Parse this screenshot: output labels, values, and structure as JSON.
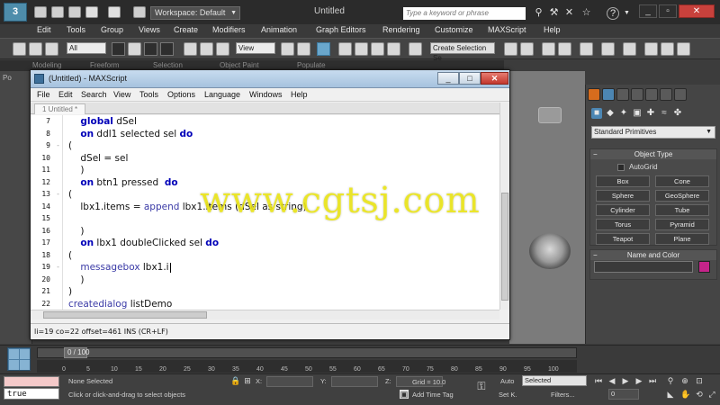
{
  "app": {
    "logo_text": "3",
    "workspace_label": "Workspace: Default",
    "document_title": "Untitled",
    "search_placeholder": "Type a keyword or phrase",
    "help_label": "?"
  },
  "main_menu": [
    "Edit",
    "Tools",
    "Group",
    "Views",
    "Create",
    "Modifiers",
    "Animation",
    "Graph Editors",
    "Rendering",
    "Customize",
    "MAXScript",
    "Help"
  ],
  "toolbar": {
    "filter_select": "All",
    "ref_coord_select": "View",
    "named_selection": "Create Selection Se"
  },
  "ribbon": {
    "tabs": [
      "Modeling",
      "Freeform",
      "Selection",
      "Object Paint",
      "Populate"
    ]
  },
  "left_strip_label": "Po",
  "command_panel": {
    "category_dropdown": "Standard Primitives",
    "object_type": {
      "header": "Object Type",
      "autogrid_label": "AutoGrid",
      "buttons": [
        "Box",
        "Cone",
        "Sphere",
        "GeoSphere",
        "Cylinder",
        "Tube",
        "Torus",
        "Pyramid",
        "Teapot",
        "Plane"
      ]
    },
    "name_and_color": {
      "header": "Name and Color",
      "swatch_color": "#c5248a"
    }
  },
  "editor": {
    "title": "(Untitled) - MAXScript",
    "menu": [
      "File",
      "Edit",
      "Search",
      "View",
      "Tools",
      "Options",
      "Language",
      "Windows",
      "Help"
    ],
    "tab_label": "1 Untitled *",
    "line_numbers": [
      "7",
      "8",
      "9",
      "10",
      "11",
      "12",
      "13",
      "14",
      "15",
      "16",
      "17",
      "18",
      "19",
      "20",
      "21",
      "22"
    ],
    "fold_markers": [
      "",
      "",
      "-",
      "",
      "",
      "",
      "-",
      "",
      "",
      "",
      "",
      "",
      "-",
      "",
      "",
      ""
    ],
    "lines": [
      {
        "indent": "    ",
        "tokens": [
          {
            "t": "kw",
            "v": "global"
          },
          {
            "t": "op",
            "v": " dSel"
          }
        ]
      },
      {
        "indent": "    ",
        "tokens": [
          {
            "t": "kw",
            "v": "on"
          },
          {
            "t": "op",
            "v": " ddl1 selected sel "
          },
          {
            "t": "kw",
            "v": "do"
          }
        ]
      },
      {
        "indent": "",
        "tokens": [
          {
            "t": "op",
            "v": "("
          }
        ]
      },
      {
        "indent": "    ",
        "tokens": [
          {
            "t": "op",
            "v": "dSel = sel"
          }
        ]
      },
      {
        "indent": "    ",
        "tokens": [
          {
            "t": "op",
            "v": ")"
          }
        ]
      },
      {
        "indent": "    ",
        "tokens": [
          {
            "t": "kw",
            "v": "on"
          },
          {
            "t": "op",
            "v": " btn1 pressed  "
          },
          {
            "t": "kw",
            "v": "do"
          }
        ]
      },
      {
        "indent": "",
        "tokens": [
          {
            "t": "op",
            "v": "("
          }
        ]
      },
      {
        "indent": "    ",
        "tokens": [
          {
            "t": "op",
            "v": "lbx1.items = "
          },
          {
            "t": "fn",
            "v": "append"
          },
          {
            "t": "op",
            "v": " lbx1.items (dSel as string)"
          }
        ]
      },
      {
        "indent": "",
        "tokens": []
      },
      {
        "indent": "    ",
        "tokens": [
          {
            "t": "op",
            "v": ")"
          }
        ]
      },
      {
        "indent": "    ",
        "tokens": [
          {
            "t": "kw",
            "v": "on"
          },
          {
            "t": "op",
            "v": " lbx1 doubleClicked sel "
          },
          {
            "t": "kw",
            "v": "do"
          }
        ]
      },
      {
        "indent": "",
        "tokens": [
          {
            "t": "op",
            "v": "("
          }
        ]
      },
      {
        "indent": "    ",
        "tokens": [
          {
            "t": "fn",
            "v": "messagebox"
          },
          {
            "t": "op",
            "v": " lbx1.i"
          }
        ],
        "caret": true
      },
      {
        "indent": "    ",
        "tokens": [
          {
            "t": "op",
            "v": ")"
          }
        ]
      },
      {
        "indent": "",
        "tokens": [
          {
            "t": "op",
            "v": ")"
          }
        ]
      },
      {
        "indent": "",
        "tokens": [
          {
            "t": "fn",
            "v": "createdialog"
          },
          {
            "t": "op",
            "v": " listDemo"
          }
        ]
      }
    ],
    "status_line": "li=19 co=22 offset=461 INS (CR+LF)"
  },
  "watermark": "www.cgtsj.com",
  "timeline": {
    "frame_label": "0 / 100",
    "ticks": [
      "0",
      "5",
      "10",
      "15",
      "20",
      "25",
      "30",
      "35",
      "40",
      "45",
      "50",
      "55",
      "60",
      "65",
      "70",
      "75",
      "80",
      "85",
      "90",
      "95",
      "100"
    ]
  },
  "status_bar": {
    "listener_result": "true",
    "selection_status": "None Selected",
    "prompt": "Click or click-and-drag to select objects",
    "x_label": "X:",
    "y_label": "Y:",
    "z_label": "Z:",
    "grid_label": "Grid = 10.0",
    "add_time_tag": "Add Time Tag",
    "auto_label": "Auto",
    "setk_label": "Set K.",
    "key_mode": "Selected",
    "filters_label": "Filters...",
    "frame_field": "0"
  },
  "colors": {
    "accent_blue": "#4e8dab",
    "watermark_yellow": "#eee814",
    "close_red": "#c8413c",
    "keyword_blue": "#0000b8"
  }
}
